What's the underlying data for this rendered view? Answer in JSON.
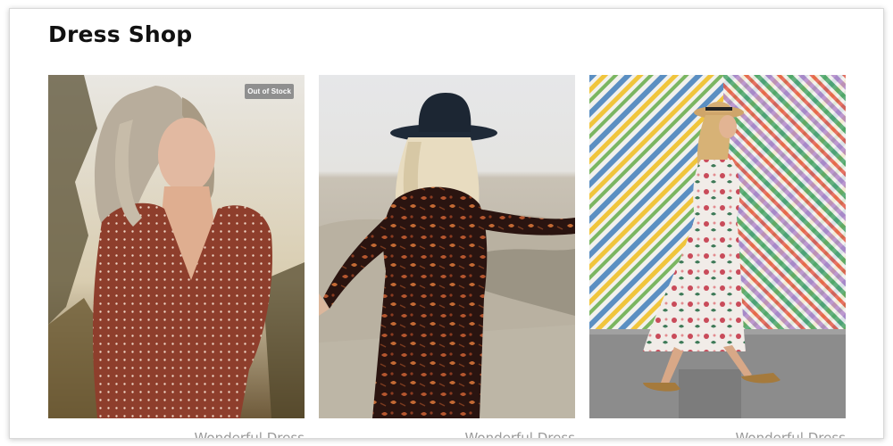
{
  "shop": {
    "title": "Dress Shop"
  },
  "products": [
    {
      "name": "Wonderful Dress",
      "badge": "Out of Stock",
      "image": "woman-in-polka-dot-dress-photo"
    },
    {
      "name": "Wonderful Dress",
      "badge": "",
      "image": "woman-in-floral-dress-with-hat-photo"
    },
    {
      "name": "Wonderful Dress",
      "badge": "",
      "image": "woman-in-white-floral-dress-photo"
    }
  ],
  "colors": {
    "title": "#111111",
    "badge_bg": "#8f8f8f",
    "product_name": "#9a9a9a"
  }
}
